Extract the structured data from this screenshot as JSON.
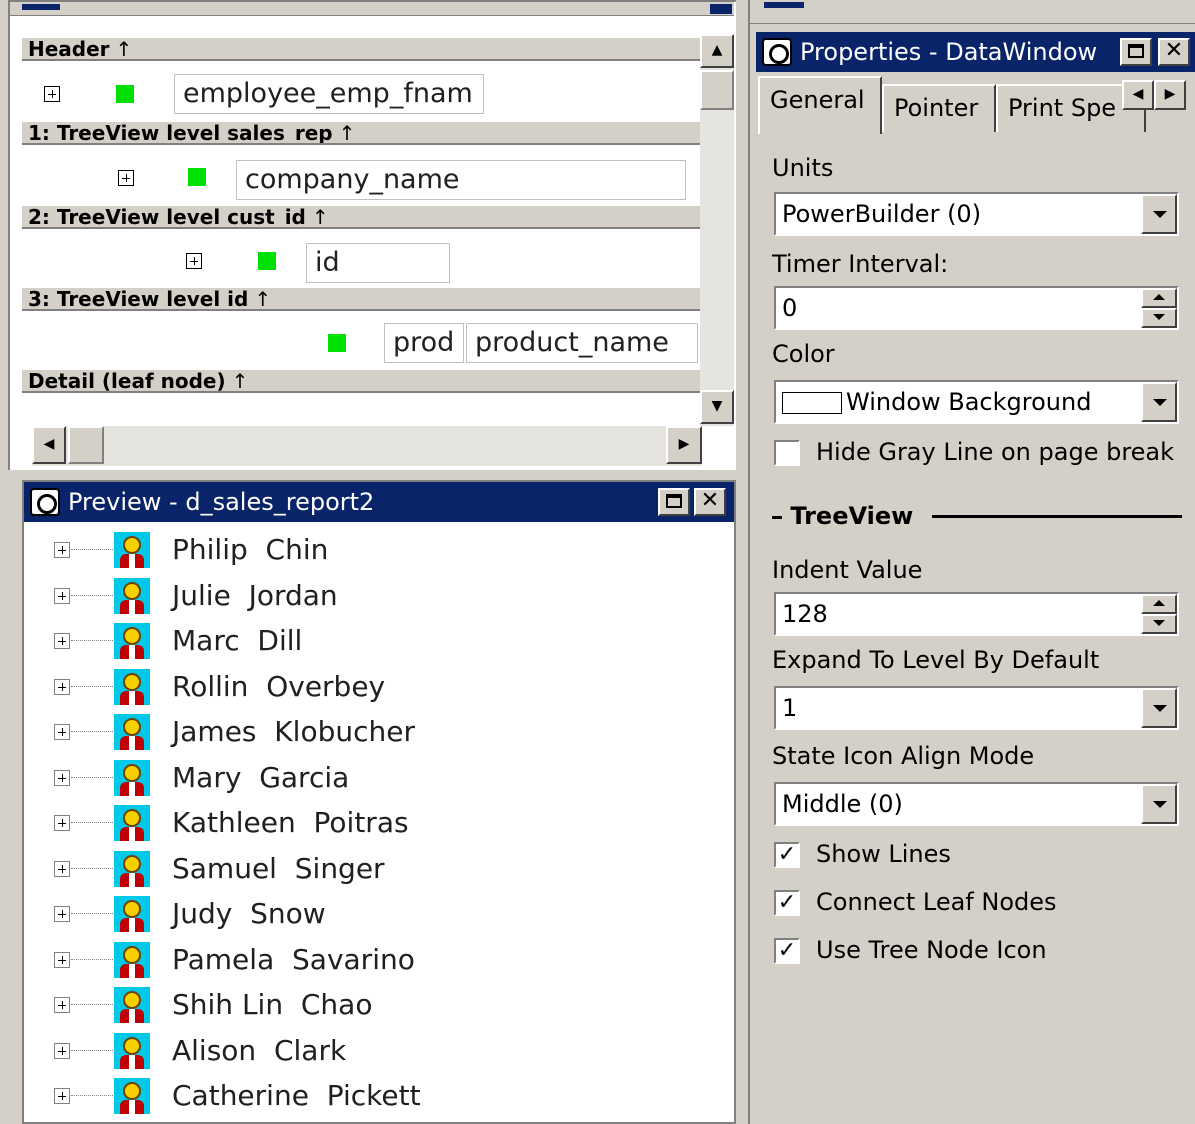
{
  "design": {
    "bands": [
      {
        "label": "Header",
        "marker": "↑"
      },
      {
        "label": "1: TreeView level sales_rep",
        "marker": "↑"
      },
      {
        "label": "2: TreeView level cust_id",
        "marker": "↑"
      },
      {
        "label": "3: TreeView level id",
        "marker": "↑"
      },
      {
        "label": "Detail (leaf node)",
        "marker": "↑"
      }
    ],
    "fields": {
      "header_field": "employee_emp_fnam",
      "level1_field": "company_name",
      "level2_field": "id",
      "level3_field_a": "prod",
      "level3_field_b": "product_name"
    }
  },
  "preview": {
    "title": "Preview - d_sales_report2",
    "rows": [
      "Philip  Chin",
      "Julie  Jordan",
      "Marc  Dill",
      "Rollin  Overbey",
      "James  Klobucher",
      "Mary  Garcia",
      "Kathleen  Poitras",
      "Samuel  Singer",
      "Judy  Snow",
      "Pamela  Savarino",
      "Shih Lin  Chao",
      "Alison  Clark",
      "Catherine  Pickett"
    ]
  },
  "properties": {
    "title": "Properties - DataWindow",
    "tabs": [
      "General",
      "Pointer",
      "Print Spe"
    ],
    "units_label": "Units",
    "units_value": "PowerBuilder (0)",
    "timer_label": "Timer Interval:",
    "timer_value": "0",
    "color_label": "Color",
    "color_value": "Window Background",
    "hide_gray_line_label": "Hide Gray Line on page break",
    "hide_gray_line_checked": false,
    "treeview_group": "TreeView",
    "indent_label": "Indent Value",
    "indent_value": "128",
    "expand_label": "Expand To Level By Default",
    "expand_value": "1",
    "state_icon_label": "State Icon Align Mode",
    "state_icon_value": "Middle (0)",
    "show_lines_label": "Show Lines",
    "show_lines_checked": true,
    "connect_leaf_label": "Connect Leaf Nodes",
    "connect_leaf_checked": true,
    "use_tree_icon_label": "Use Tree Node Icon",
    "use_tree_icon_checked": true
  },
  "colors": {
    "titlebar": "#0a246a",
    "window_bg": "#d4d0c8",
    "green_marker": "#00e000",
    "person_icon_bg": "#00c8e8"
  },
  "icons": {
    "expand": "plus-box-icon",
    "person": "person-icon",
    "titlebar": "datawindow-icon"
  }
}
